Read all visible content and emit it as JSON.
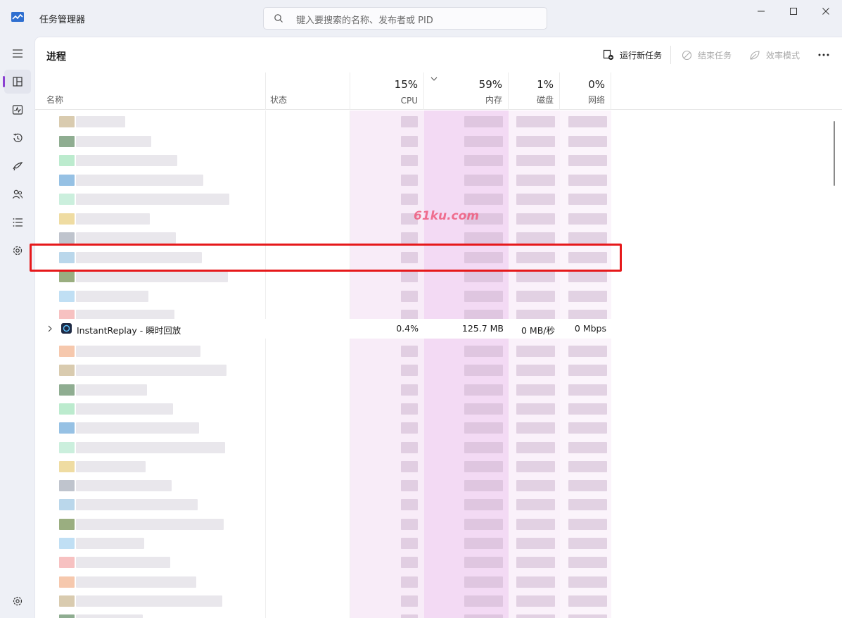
{
  "window": {
    "title": "任务管理器",
    "search_placeholder": "键入要搜索的名称、发布者或 PID",
    "minimize_icon": "minimize-icon",
    "maximize_icon": "maximize-icon",
    "close_icon": "close-icon"
  },
  "sidebar": {
    "items": [
      {
        "name": "hamburger-menu-icon"
      },
      {
        "name": "processes-icon",
        "active": true
      },
      {
        "name": "performance-icon"
      },
      {
        "name": "app-history-icon"
      },
      {
        "name": "startup-apps-icon"
      },
      {
        "name": "users-icon"
      },
      {
        "name": "details-icon"
      },
      {
        "name": "services-icon"
      }
    ],
    "settings_icon": "settings-icon"
  },
  "page": {
    "title": "进程",
    "actions": {
      "run_new_task": "运行新任务",
      "end_task": "结束任务",
      "efficiency_mode": "效率模式"
    }
  },
  "columns": {
    "name": "名称",
    "status": "状态",
    "cpu": {
      "pct": "15%",
      "label": "CPU"
    },
    "memory": {
      "pct": "59%",
      "label": "内存"
    },
    "disk": {
      "pct": "1%",
      "label": "磁盘"
    },
    "network": {
      "pct": "0%",
      "label": "网络"
    }
  },
  "highlighted_process": {
    "name": "InstantReplay - 瞬时回放",
    "cpu": "0.4%",
    "memory": "125.7 MB",
    "disk": "0 MB/秒",
    "network": "0 Mbps"
  },
  "watermark": "61ku.com",
  "colors": {
    "accent": "#8a3fd1",
    "highlight_border": "#e6191b",
    "memory_heat": "#efc9f0",
    "cpu_heat": "#f6e6f7"
  }
}
